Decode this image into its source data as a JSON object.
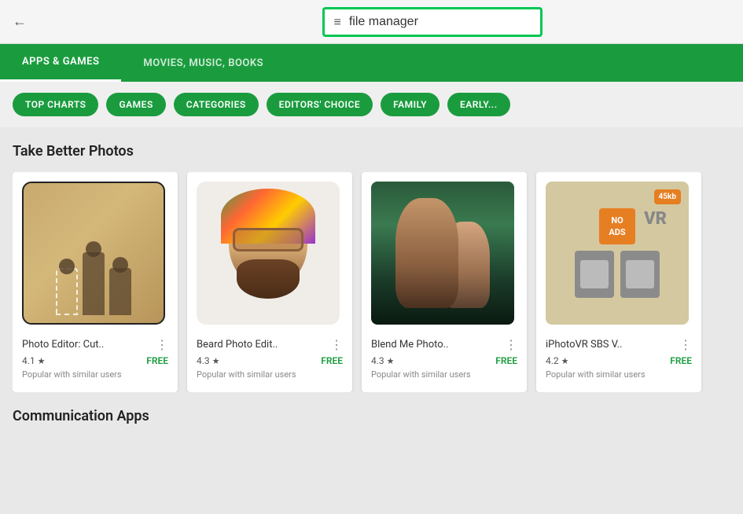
{
  "topBar": {
    "searchPlaceholder": "file manager",
    "searchValue": "file manager"
  },
  "navBar": {
    "tabs": [
      {
        "id": "apps-games",
        "label": "APPS & GAMES",
        "active": true
      },
      {
        "id": "movies",
        "label": "MOVIES, MUSIC, BOOKS",
        "active": false
      }
    ]
  },
  "pills": [
    {
      "id": "top-charts",
      "label": "TOP CHARTS"
    },
    {
      "id": "games",
      "label": "GAMES"
    },
    {
      "id": "categories",
      "label": "CATEGORIES"
    },
    {
      "id": "editors-choice",
      "label": "EDITORS' CHOICE"
    },
    {
      "id": "family",
      "label": "FAMILY"
    },
    {
      "id": "early-access",
      "label": "EARLY..."
    }
  ],
  "section1": {
    "title": "Take Better Photos",
    "apps": [
      {
        "id": "photo-editor",
        "name": "Photo Editor: Cut..",
        "rating": "4.1",
        "price": "FREE",
        "popular": "Popular with similar users"
      },
      {
        "id": "beard-photo",
        "name": "Beard Photo Edit..",
        "rating": "4.3",
        "price": "FREE",
        "popular": "Popular with similar users"
      },
      {
        "id": "blend-me",
        "name": "Blend Me Photo..",
        "rating": "4.3",
        "price": "FREE",
        "popular": "Popular with similar users"
      },
      {
        "id": "iphoto-vr",
        "name": "iPhotoVR SBS V..",
        "rating": "4.2",
        "price": "FREE",
        "popular": "Popular with similar users",
        "badge": "45kb"
      }
    ]
  },
  "section2": {
    "title": "Communication Apps"
  },
  "icons": {
    "back": "←",
    "hamburger": "≡",
    "star": "★",
    "more": "⋮"
  }
}
